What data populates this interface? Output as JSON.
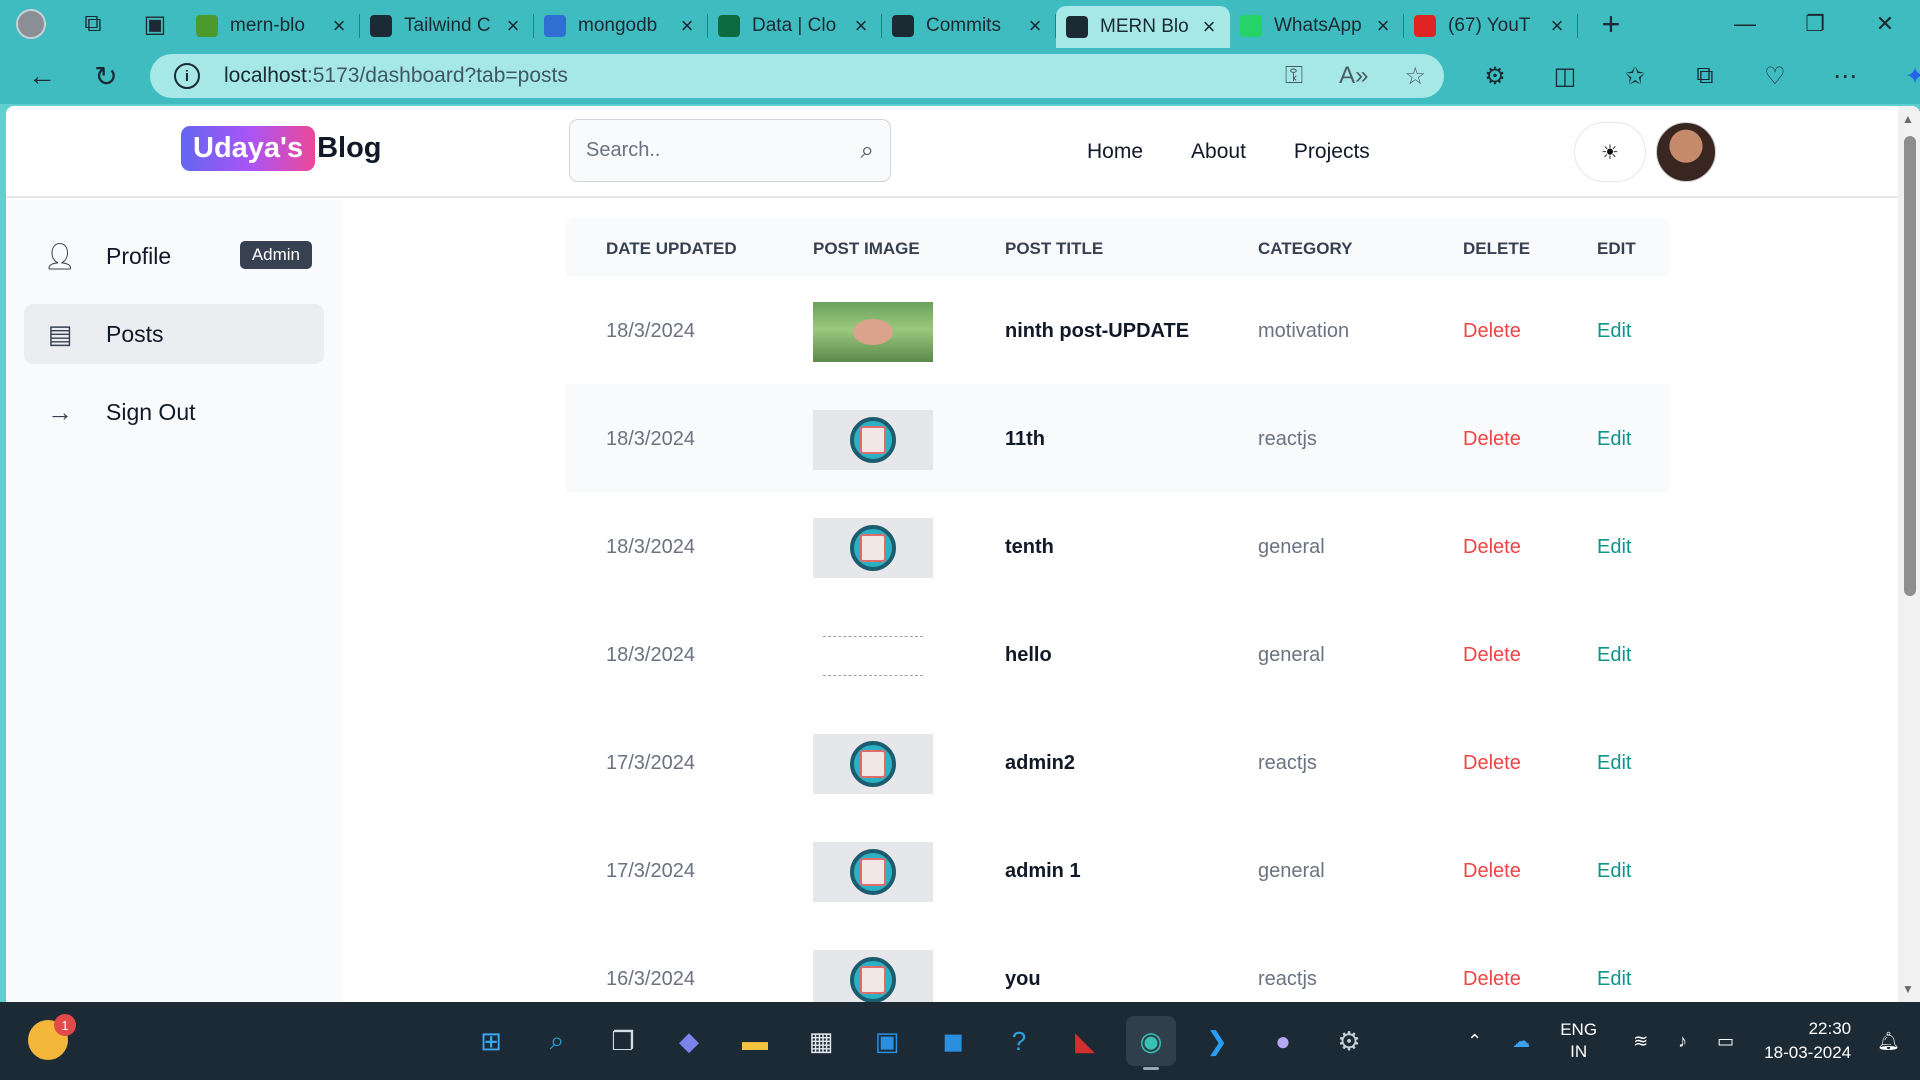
{
  "browser": {
    "tabs": [
      {
        "title": "mern-blo",
        "favicon_color": "#4a9a2e",
        "active": false
      },
      {
        "title": "Tailwind C",
        "favicon_color": "#1b2a33",
        "active": false
      },
      {
        "title": "mongodb",
        "favicon_color": "#2f6fd1",
        "active": false
      },
      {
        "title": "Data | Clo",
        "favicon_color": "#0e6b3f",
        "active": false
      },
      {
        "title": "Commits",
        "favicon_color": "#1b2a33",
        "active": false
      },
      {
        "title": "MERN Blo",
        "favicon_color": "#1b2a33",
        "active": true
      },
      {
        "title": "WhatsApp",
        "favicon_color": "#25d366",
        "active": false
      },
      {
        "title": "(67) YouT",
        "favicon_color": "#e02424",
        "active": false
      }
    ],
    "url_host": "localhost",
    "url_rest": ":5173/dashboard?tab=posts"
  },
  "header": {
    "logo_badge": "Udaya's",
    "logo_rest": "Blog",
    "search_placeholder": "Search..",
    "nav": [
      "Home",
      "About",
      "Projects"
    ]
  },
  "sidebar": {
    "items": [
      {
        "label": "Profile",
        "badge": "Admin",
        "icon": "user-icon",
        "active": false
      },
      {
        "label": "Posts",
        "icon": "document-icon",
        "active": true
      },
      {
        "label": "Sign Out",
        "icon": "arrow-right-icon",
        "active": false
      }
    ]
  },
  "table": {
    "headers": [
      "DATE UPDATED",
      "POST IMAGE",
      "POST TITLE",
      "CATEGORY",
      "DELETE",
      "EDIT"
    ],
    "rows": [
      {
        "date": "18/3/2024",
        "image": "nature",
        "title": "ninth post-UPDATE",
        "category": "motivation",
        "delete": "Delete",
        "edit": "Edit"
      },
      {
        "date": "18/3/2024",
        "image": "gear",
        "title": "11th",
        "category": "reactjs",
        "delete": "Delete",
        "edit": "Edit"
      },
      {
        "date": "18/3/2024",
        "image": "gear",
        "title": "tenth",
        "category": "general",
        "delete": "Delete",
        "edit": "Edit"
      },
      {
        "date": "18/3/2024",
        "image": "doc",
        "title": "hello",
        "category": "general",
        "delete": "Delete",
        "edit": "Edit"
      },
      {
        "date": "17/3/2024",
        "image": "gear",
        "title": "admin2",
        "category": "reactjs",
        "delete": "Delete",
        "edit": "Edit"
      },
      {
        "date": "17/3/2024",
        "image": "gear",
        "title": "admin 1",
        "category": "general",
        "delete": "Delete",
        "edit": "Edit"
      },
      {
        "date": "16/3/2024",
        "image": "gear",
        "title": "you",
        "category": "reactjs",
        "delete": "Delete",
        "edit": "Edit"
      }
    ]
  },
  "taskbar": {
    "widget_badge": "1",
    "lang_top": "ENG",
    "lang_bottom": "IN",
    "time": "22:30",
    "date": "18-03-2024"
  },
  "colors": {
    "browser_chrome": "#3fbcc0",
    "delete": "#ef4444",
    "edit": "#0d9488",
    "logo_gradient": [
      "#6366f1",
      "#a855f7",
      "#ec4899"
    ]
  }
}
